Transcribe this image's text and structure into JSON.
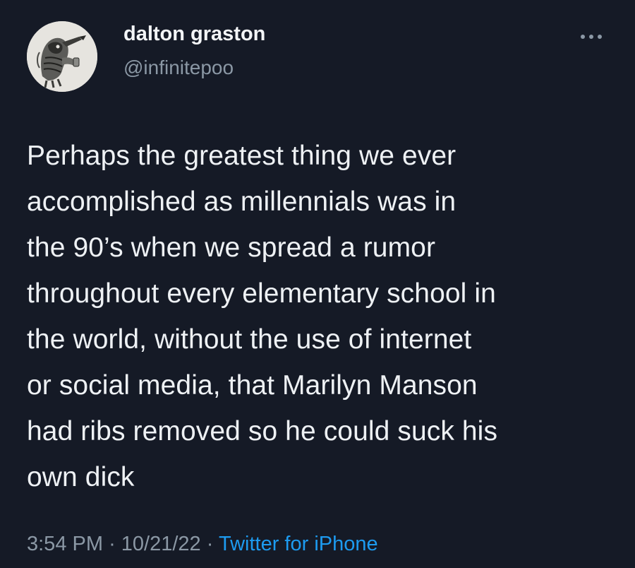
{
  "author": {
    "display_name": "dalton graston",
    "handle": "@infinitepoo"
  },
  "tweet": {
    "text_lines": [
      "Perhaps the greatest thing we ever",
      "accomplished as millennials was in",
      "the 90’s when we spread a rumor",
      "throughout every elementary school in",
      "the world, without the use of internet",
      "or social media, that Marilyn Manson",
      "had ribs removed so he could suck his",
      "own dick"
    ],
    "time": "3:54 PM",
    "date": "10/21/22",
    "separator": "·",
    "source": "Twitter for iPhone"
  },
  "icons": {
    "more": "more-horizontal-icon",
    "avatar": "avatar-illustration"
  },
  "colors": {
    "background": "#151a26",
    "primary_text": "#eef1f4",
    "secondary_text": "#8b98a5",
    "link": "#1d9bf0"
  }
}
